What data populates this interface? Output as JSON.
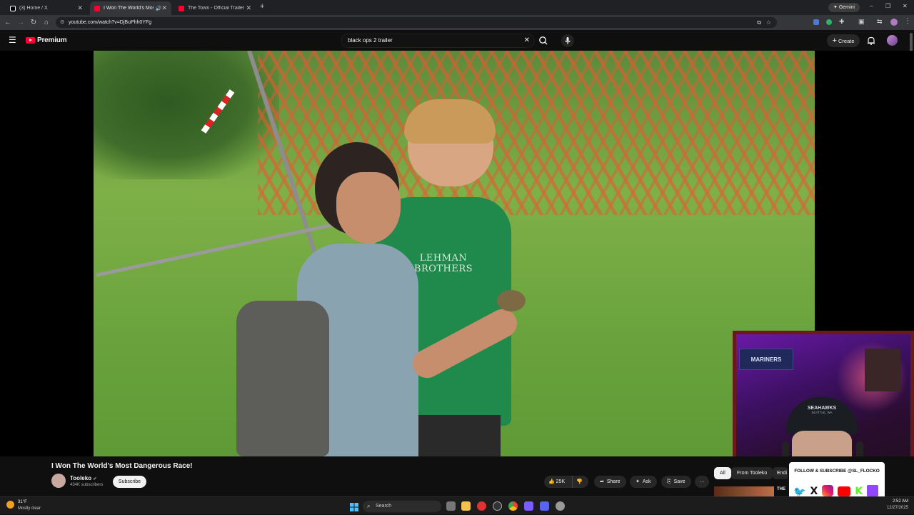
{
  "browser": {
    "tabs": [
      {
        "title": "(3) Home / X",
        "favicon_color": "#ffffff",
        "active": false
      },
      {
        "title": "I Won The World's Most Da",
        "favicon_color": "#ff0033",
        "active": true
      },
      {
        "title": "The Town - Official Trailer [HD]",
        "favicon_color": "#ff0033",
        "active": false
      }
    ],
    "new_tab_label": "+",
    "gemini_label": "Gemini",
    "url": "youtube.com/watch?v=DjBuPhh0YFg",
    "window_controls": {
      "minimize": "–",
      "restore": "❐",
      "close": "✕"
    }
  },
  "youtube": {
    "logo_text": "Premium",
    "search_value": "black ops 2 trailer",
    "create_label": "Create",
    "video": {
      "title": "I Won The World's Most Dangerous Race!",
      "shirt_text": "LEHMAN BROTHERS"
    },
    "channel": {
      "name": "Tooleko",
      "verified": "✔",
      "subscribers": "434K subscribers",
      "subscribe_label": "Subscribe"
    },
    "actions": {
      "likes": "25K",
      "share": "Share",
      "ask": "Ask",
      "save": "Save",
      "more": "···"
    },
    "chips": [
      "All",
      "From Tooleko",
      "Endi"
    ],
    "sidebar_preview_title": "THE"
  },
  "webcam": {
    "poster_text": "MARINERS",
    "cap_text": "SEAHAWKS",
    "cap_sub": "SEATTLE, WA"
  },
  "follow_banner": {
    "text": "FOLLOW & SUBSCRIBE @SL_FLOCKO"
  },
  "taskbar": {
    "weather_temp": "31°F",
    "weather_desc": "Mostly clear",
    "search_label": "Search",
    "time": "2:52 AM",
    "date": "12/27/2025"
  }
}
